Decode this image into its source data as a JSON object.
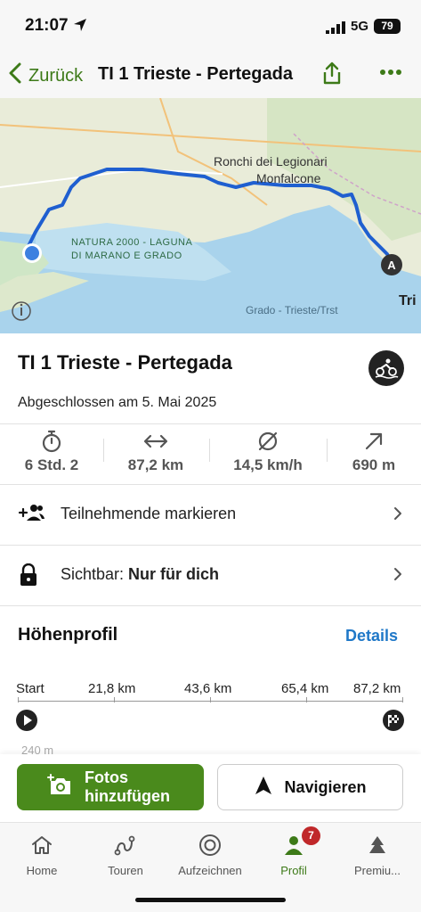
{
  "status": {
    "time": "21:07",
    "network": "5G",
    "battery": "79"
  },
  "nav": {
    "back_label": "Zurück",
    "title": "TI 1 Trieste - Pertegada"
  },
  "map": {
    "labels": {
      "ronchi": "Ronchi dei Legionari",
      "monfalcone": "Monfalcone",
      "natura_line1": "NATURA 2000 - LAGUNA",
      "natura_line2": "DI MARANO E GRADO",
      "grado": "Grado - Trieste/Trst",
      "trieste_cut": "Tri",
      "marker_a": "A"
    },
    "route_color": "#1f5fd0",
    "water_color": "#a9d3ec",
    "land_color": "#e9ecd9"
  },
  "tour": {
    "title": "TI 1 Trieste - Pertegada",
    "completed": "Abgeschlossen am 5. Mai 2025",
    "sport_icon": "cycling-icon"
  },
  "stats": {
    "duration": "6 Std. 2",
    "distance": "87,2 km",
    "speed": "14,5 km/h",
    "elevation": "690 m"
  },
  "rows": {
    "tag_participants": "Teilnehmende markieren",
    "visibility_prefix": "Sichtbar: ",
    "visibility_value": "Nur für dich"
  },
  "elevation": {
    "title": "Höhenprofil",
    "details_link": "Details",
    "axis": [
      "Start",
      "21,8 km",
      "43,6 km",
      "65,4 km",
      "87,2 km"
    ],
    "y_label": "240 m"
  },
  "actions": {
    "photos_label": "Fotos hinzufügen",
    "navigate_label": "Navigieren"
  },
  "tabs": [
    {
      "label": "Home",
      "icon": "home-icon"
    },
    {
      "label": "Touren",
      "icon": "route-icon"
    },
    {
      "label": "Aufzeichnen",
      "icon": "record-icon"
    },
    {
      "label": "Profil",
      "icon": "profile-icon",
      "badge": "7"
    },
    {
      "label": "Premiu...",
      "icon": "premium-icon"
    }
  ],
  "colors": {
    "accent_green": "#3d7a18",
    "button_green": "#4a8a1c",
    "link_blue": "#1f78c8",
    "badge_red": "#c0282a"
  }
}
